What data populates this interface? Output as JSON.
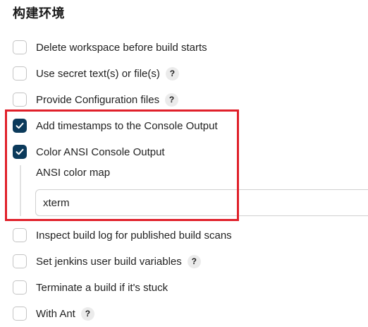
{
  "section": {
    "title": "构建环境"
  },
  "options": [
    {
      "label": "Delete workspace before build starts",
      "checked": false,
      "help": ""
    },
    {
      "label": "Use secret text(s) or file(s)",
      "checked": false,
      "help": "?"
    },
    {
      "label": "Provide Configuration files",
      "checked": false,
      "help": "?"
    },
    {
      "label": "Add timestamps to the Console Output",
      "checked": true,
      "help": ""
    },
    {
      "label": "Color ANSI Console Output",
      "checked": true,
      "help": ""
    },
    {
      "label": "Inspect build log for published build scans",
      "checked": false,
      "help": ""
    },
    {
      "label": "Set jenkins user build variables",
      "checked": false,
      "help": "?"
    },
    {
      "label": "Terminate a build if it's stuck",
      "checked": false,
      "help": ""
    },
    {
      "label": "With Ant",
      "checked": false,
      "help": "?"
    }
  ],
  "ansi": {
    "field_label": "ANSI color map",
    "value": "xterm"
  },
  "colors": {
    "checked": "#0b3a5b",
    "highlight": "#e0202a"
  }
}
